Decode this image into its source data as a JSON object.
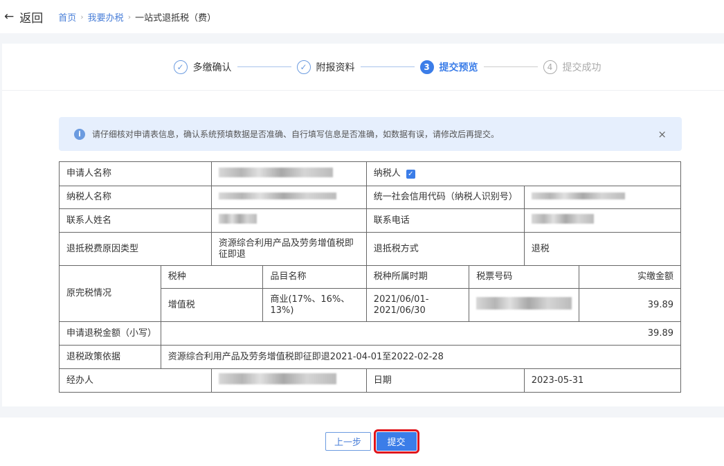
{
  "header": {
    "back": "返回",
    "breadcrumb": [
      "首页",
      "我要办税",
      "一站式退抵税（费）"
    ]
  },
  "steps": [
    {
      "label": "多缴确认",
      "state": "done"
    },
    {
      "label": "附报资料",
      "state": "done"
    },
    {
      "label": "提交预览",
      "num": "3",
      "state": "active"
    },
    {
      "label": "提交成功",
      "num": "4",
      "state": "pending"
    }
  ],
  "alert": "请仔细核对申请表信息，确认系统预填数据是否准确、自行填写信息是否准确，如数据有误，请修改后再提交。",
  "table": {
    "applicant_label": "申请人名称",
    "taxpayer_check_label": "纳税人",
    "taxpayer_name_label": "纳税人名称",
    "credit_code_label": "统一社会信用代码（纳税人识别号）",
    "contact_label": "联系人姓名",
    "phone_label": "联系电话",
    "reason_label": "退抵税费原因类型",
    "reason_value": "资源综合利用产品及劳务增值税即征即退",
    "method_label": "退抵税方式",
    "method_value": "退税",
    "original_label": "原完税情况",
    "headers": [
      "税种",
      "品目名称",
      "税种所属时期",
      "税票号码",
      "实缴金额"
    ],
    "row": {
      "tax_type": "增值税",
      "item": "商业(17%、16%、13%)",
      "period": "2021/06/01-2021/06/30",
      "amount": "39.89"
    },
    "refund_label": "申请退税金额（小写）",
    "refund_value": "39.89",
    "policy_label": "退税政策依据",
    "policy_value": "资源综合利用产品及劳务增值税即征即退2021-04-01至2022-02-28",
    "handler_label": "经办人",
    "date_label": "日期",
    "date_value": "2023-05-31"
  },
  "buttons": {
    "prev": "上一步",
    "submit": "提交"
  }
}
